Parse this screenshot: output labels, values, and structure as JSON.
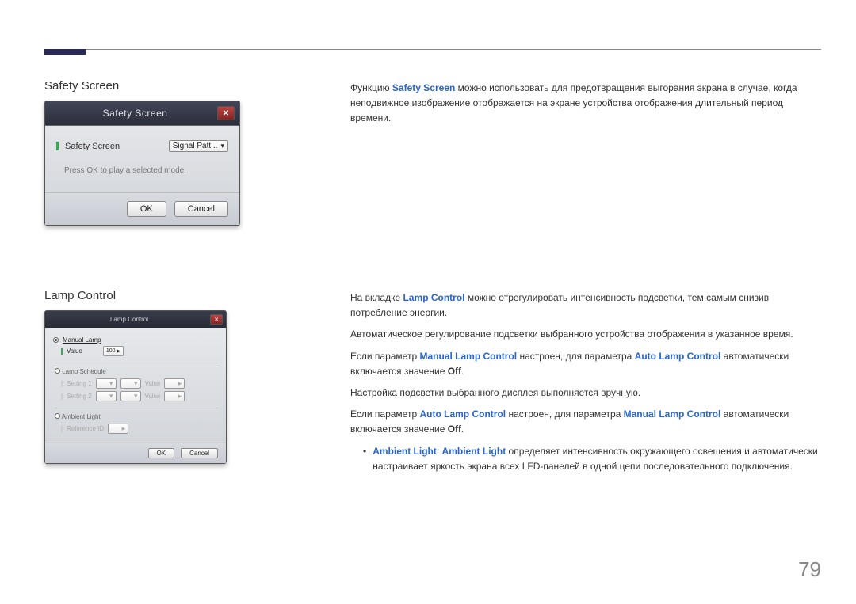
{
  "page_number": "79",
  "section1": {
    "title": "Safety Screen",
    "dialog": {
      "title": "Safety Screen",
      "field_label": "Safety Screen",
      "select_value": "Signal Patt...",
      "hint": "Press OK to play a selected mode.",
      "ok": "OK",
      "cancel": "Cancel"
    },
    "desc": {
      "p1_pre": "Функцию ",
      "p1_blue": "Safety Screen",
      "p1_post": " можно использовать для предотвращения выгорания экрана в случае, когда неподвижное изображение отображается на экране устройства отображения длительный период времени."
    }
  },
  "section2": {
    "title": "Lamp Control",
    "dialog": {
      "title": "Lamp Control",
      "radio_manual": "Manual Lamp",
      "value_label": "Value",
      "value_val": "100",
      "group_schedule": "Lamp Schedule",
      "setting1": "Setting 1",
      "setting2": "Setting 2",
      "sched_value": "Value",
      "group_ambient": "Ambient Light",
      "reference": "Reference ID",
      "ok": "OK",
      "cancel": "Cancel"
    },
    "desc": {
      "p1_pre": "На вкладке ",
      "p1_blue": "Lamp Control",
      "p1_post": " можно отрегулировать интенсивность подсветки, тем самым снизив потребление энергии.",
      "p2": "Автоматическое регулирование подсветки выбранного устройства отображения в указанное время.",
      "p3_pre": "Если параметр ",
      "p3_b1": "Manual Lamp Control",
      "p3_mid": " настроен, для параметра ",
      "p3_b2": "Auto Lamp Control",
      "p3_post": " автоматически включается значение ",
      "p3_off": "Off",
      "p4": "Настройка подсветки выбранного дисплея выполняется вручную.",
      "p5_pre": "Если параметр ",
      "p5_b1": "Auto Lamp Control",
      "p5_mid": " настроен, для параметра ",
      "p5_b2": "Manual Lamp Control",
      "p5_post": " автоматически включается значение ",
      "p5_off": "Off",
      "bullet_b1": "Ambient Light",
      "bullet_sep": ": ",
      "bullet_b2": "Ambient Light",
      "bullet_post": " определяет интенсивность окружающего освещения и автоматически настраивает яркость экрана всех LFD-панелей в одной цепи последовательного подключения."
    }
  }
}
